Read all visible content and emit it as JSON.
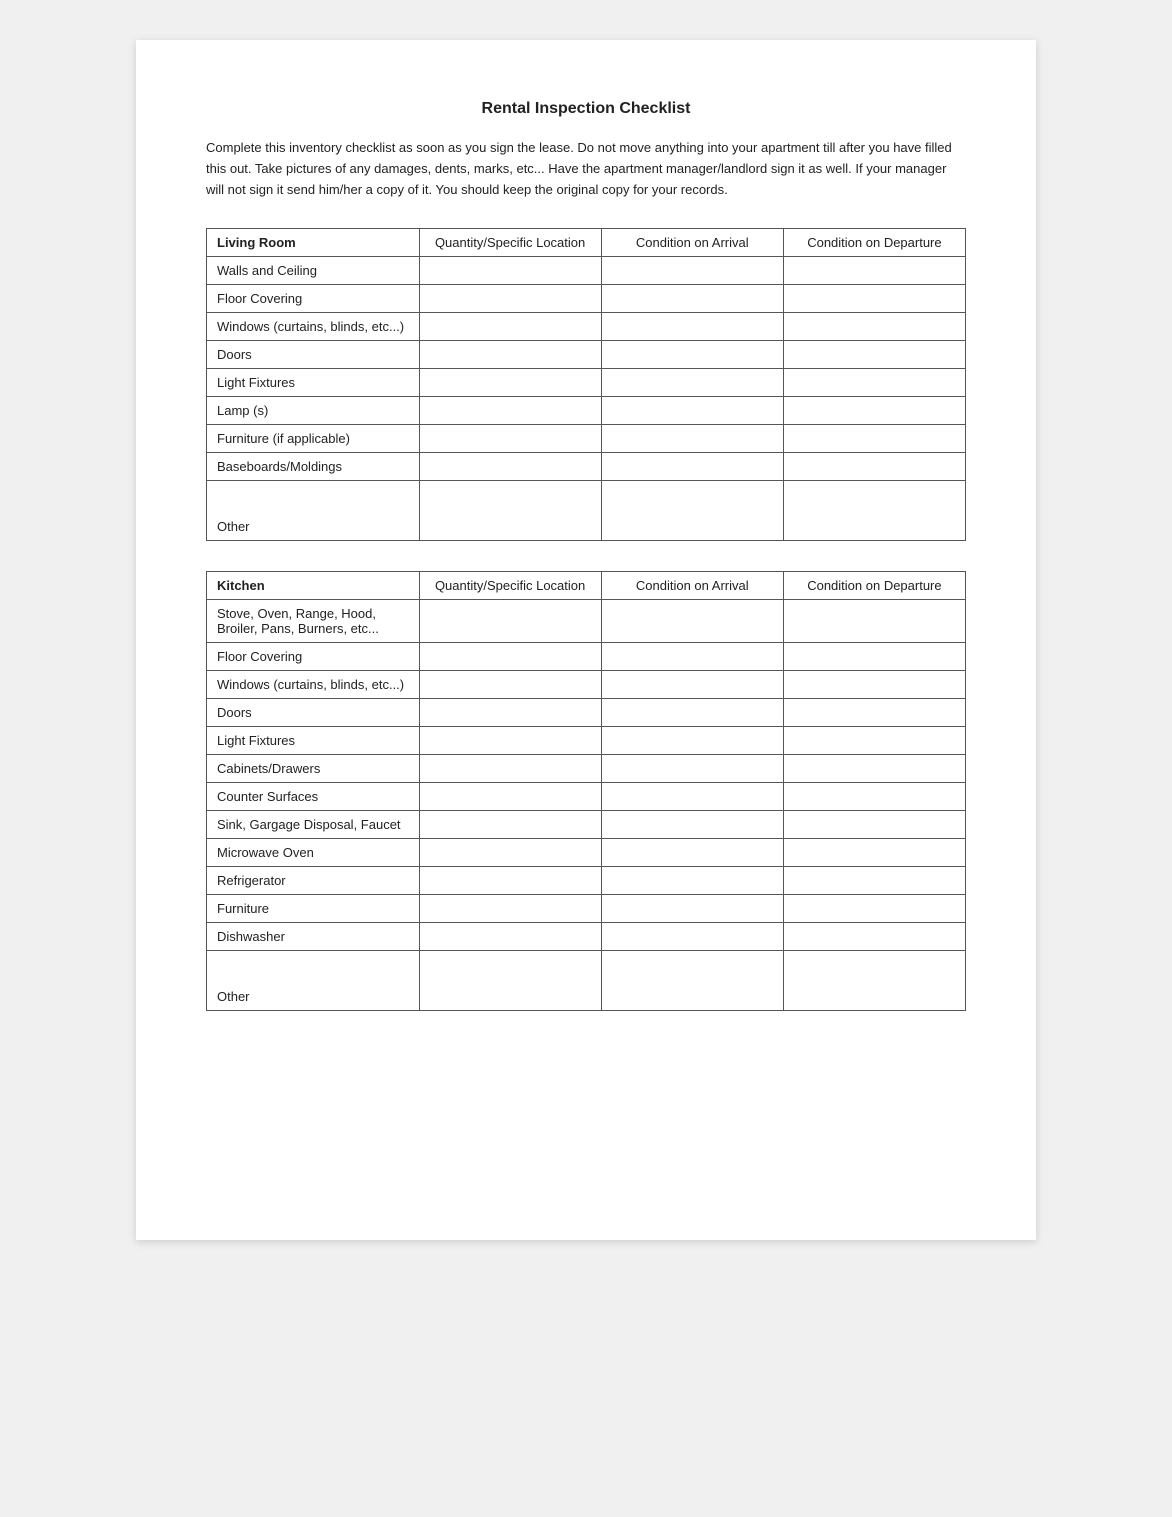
{
  "page": {
    "title": "Rental Inspection Checklist",
    "intro": "Complete this inventory checklist as soon as you sign the lease.  Do not move anything into your apartment till after you have filled this out.  Take pictures of any damages, dents, marks, etc... Have the apartment manager/landlord sign it as well.  If your manager will not sign it send him/her a copy of it.  You should keep the original copy for your records."
  },
  "tables": [
    {
      "section_label": "Living Room",
      "col_qty": "Quantity/Specific Location",
      "col_arrival": "Condition on Arrival",
      "col_departure": "Condition on Departure",
      "rows": [
        "Walls and Ceiling",
        "Floor Covering",
        "Windows (curtains, blinds, etc...)",
        "Doors",
        "Light Fixtures",
        "Lamp (s)",
        "Furniture (if applicable)",
        "Baseboards/Moldings",
        "Other"
      ]
    },
    {
      "section_label": "Kitchen",
      "col_qty": "Quantity/Specific Location",
      "col_arrival": "Condition on Arrival",
      "col_departure": "Condition on Departure",
      "rows": [
        "Stove, Oven, Range, Hood, Broiler, Pans, Burners, etc...",
        "Floor Covering",
        "Windows (curtains, blinds, etc...)",
        "Doors",
        "Light Fixtures",
        "Cabinets/Drawers",
        "Counter Surfaces",
        "Sink, Gargage Disposal, Faucet",
        "Microwave Oven",
        "Refrigerator",
        "Furniture",
        "Dishwasher",
        "Other"
      ]
    }
  ]
}
